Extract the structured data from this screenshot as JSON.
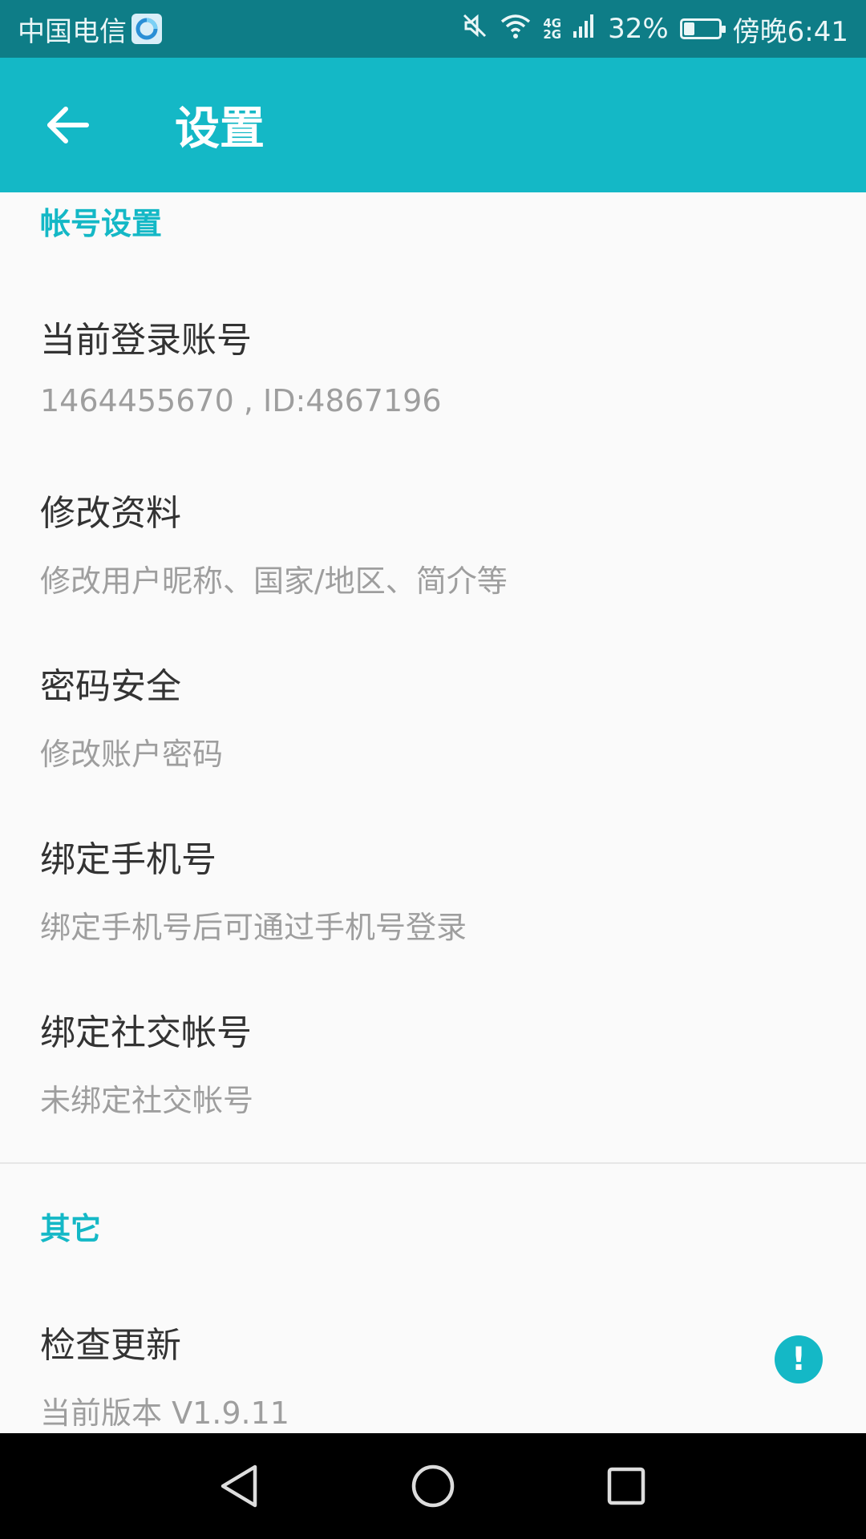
{
  "status_bar": {
    "carrier": "中国电信",
    "net_top": "4G",
    "net_bottom": "2G",
    "battery_percent": "32%",
    "battery_level": 0.32,
    "time": "傍晚6:41"
  },
  "app_bar": {
    "title": "设置"
  },
  "sections": {
    "account": {
      "header": "帐号设置",
      "items": [
        {
          "title": "当前登录账号",
          "subtitle": "1464455670 , ID:4867196"
        },
        {
          "title": "修改资料",
          "subtitle": "修改用户昵称、国家/地区、简介等"
        },
        {
          "title": "密码安全",
          "subtitle": "修改账户密码"
        },
        {
          "title": "绑定手机号",
          "subtitle": "绑定手机号后可通过手机号登录"
        },
        {
          "title": "绑定社交帐号",
          "subtitle": "未绑定社交帐号"
        }
      ]
    },
    "other": {
      "header": "其它",
      "items": [
        {
          "title": "检查更新",
          "subtitle": "当前版本 V1.9.11",
          "badge": "!"
        }
      ]
    }
  },
  "colors": {
    "accent": "#14b8c6",
    "status_bar": "#0e7d87",
    "background": "#fafafa"
  },
  "icons": {
    "back": "arrow-left-icon",
    "mute": "mute-icon",
    "wifi": "wifi-icon",
    "signal": "signal-icon",
    "battery": "battery-icon",
    "nav_back": "triangle-back-icon",
    "nav_home": "circle-home-icon",
    "nav_recents": "square-recents-icon"
  }
}
